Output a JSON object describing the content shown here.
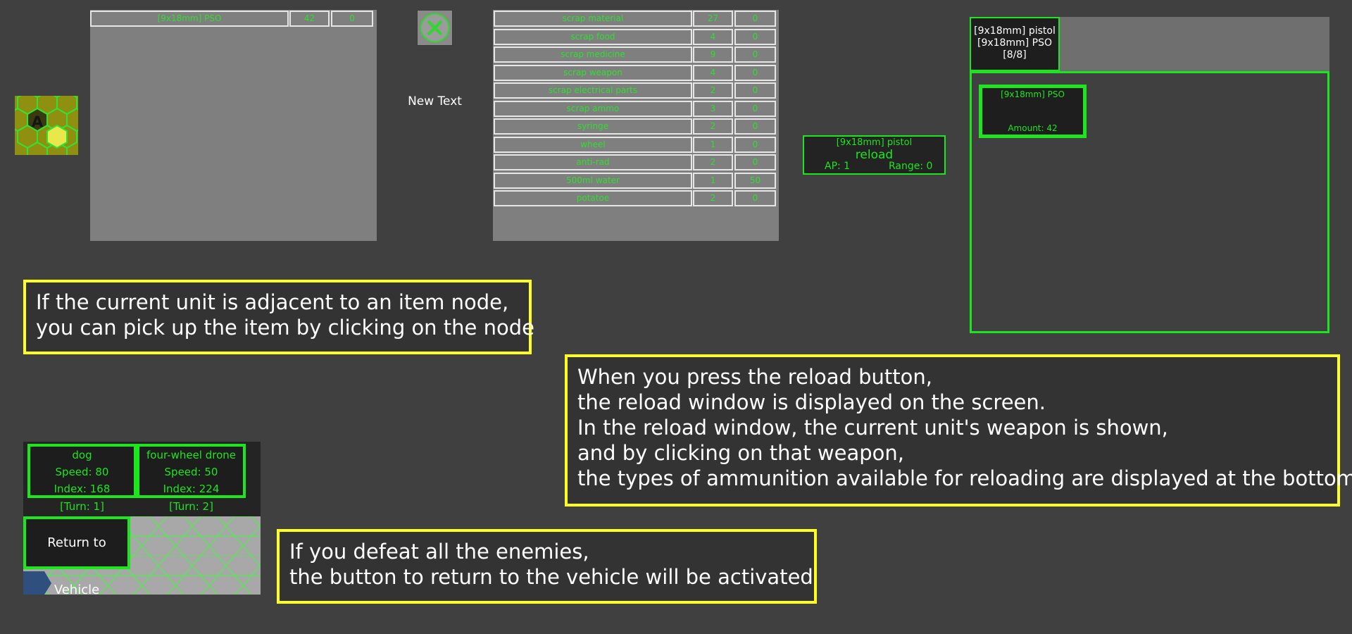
{
  "colors": {
    "background": "#404040",
    "panel_grey": "#7f7f7f",
    "ui_green": "#1ee61e",
    "caption_border": "#ffff1e",
    "cell_border": "#e6e6e6",
    "hex_yellow": "#8f8f10"
  },
  "hex_thumb": {
    "letter": "A"
  },
  "item_node": {
    "columns": [
      "name",
      "count",
      "take"
    ],
    "rows": [
      {
        "name": "[9x18mm] PSO",
        "count": "42",
        "take": "0"
      }
    ]
  },
  "center": {
    "close_icon": "close-icon",
    "label": "New Text"
  },
  "inventory": {
    "columns": [
      "name",
      "count",
      "take"
    ],
    "rows": [
      {
        "name": "scrap material",
        "count": "27",
        "take": "0"
      },
      {
        "name": "scrap food",
        "count": "4",
        "take": "0"
      },
      {
        "name": "scrap medicine",
        "count": "9",
        "take": "0"
      },
      {
        "name": "scrap weapon",
        "count": "4",
        "take": "0"
      },
      {
        "name": "scrap electrical parts",
        "count": "2",
        "take": "0"
      },
      {
        "name": "scrap ammo",
        "count": "3",
        "take": "0"
      },
      {
        "name": "syringe",
        "count": "2",
        "take": "0"
      },
      {
        "name": "wheel",
        "count": "1",
        "take": "0"
      },
      {
        "name": "anti-rad",
        "count": "2",
        "take": "0"
      },
      {
        "name": "500ml water",
        "count": "1",
        "take": "50"
      },
      {
        "name": "potatoe",
        "count": "2",
        "take": "0"
      }
    ]
  },
  "weapon_action": {
    "weapon": "[9x18mm] pistol",
    "action": "reload",
    "ap": "AP: 1",
    "range": "Range: 0"
  },
  "reload_window": {
    "tab_lines": [
      "[9x18mm] pistol",
      "[9x18mm] PSO",
      "[8/8]"
    ],
    "ammo": {
      "name": "[9x18mm] PSO",
      "amount": "Amount: 42"
    }
  },
  "captions": {
    "pickup": [
      "If the current unit is adjacent to an item node,",
      "you can pick up the item by clicking on the node"
    ],
    "reload": [
      "When you press the reload button,",
      "the reload window is displayed on the screen.",
      "In the reload window, the current unit's weapon is shown,",
      "and by clicking on that weapon,",
      "the types of ammunition available for reloading are displayed at the bottom"
    ],
    "return": [
      "If you defeat all the enemies,",
      "the button to return to the vehicle will be activated"
    ]
  },
  "turn_order": [
    {
      "name": "dog",
      "speed": "Speed: 80",
      "index": "Index: 168",
      "turn": "[Turn: 1]"
    },
    {
      "name": "four-wheel drone",
      "speed": "Speed: 50",
      "index": "Index: 224",
      "turn": "[Turn: 2]"
    }
  ],
  "return_button": {
    "label": "Return to Vehicle"
  }
}
